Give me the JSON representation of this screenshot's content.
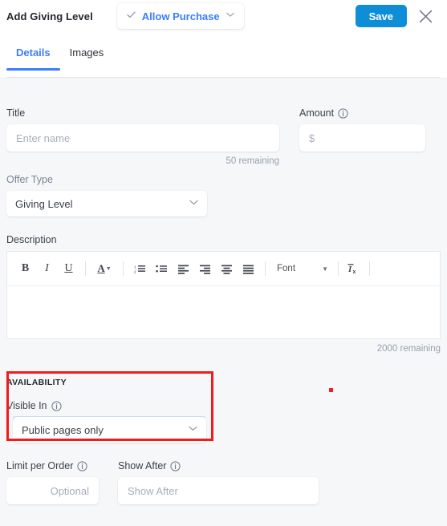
{
  "header": {
    "title": "Add Giving Level",
    "purchase_dropdown": {
      "check_icon": "check-icon",
      "label": "Allow Purchase",
      "caret_icon": "chevron-down-icon"
    },
    "save_label": "Save",
    "close_icon": "close-icon"
  },
  "tabs": [
    {
      "label": "Details",
      "active": true
    },
    {
      "label": "Images",
      "active": false
    }
  ],
  "form": {
    "title_field": {
      "label": "Title",
      "placeholder": "Enter name",
      "value": "",
      "counter": "50 remaining"
    },
    "amount_field": {
      "label": "Amount",
      "info_icon": "info-icon",
      "placeholder": "$",
      "value": ""
    },
    "offer_type": {
      "label": "Offer Type",
      "value": "Giving Level",
      "chevron_icon": "chevron-down-icon"
    },
    "description": {
      "label": "Description",
      "value": "",
      "counter": "2000 remaining",
      "toolbar": {
        "bold": "B",
        "italic": "I",
        "underline": "U",
        "text_color": "A",
        "ordered_list_icon": "ordered-list-icon",
        "bullet_list_icon": "bullet-list-icon",
        "align_left_icon": "align-left-icon",
        "align_right_icon": "align-right-icon",
        "align_center_icon": "align-center-icon",
        "justify_icon": "align-justify-icon",
        "font_label": "Font",
        "font_caret_icon": "caret-down-icon",
        "remove_format": "Ix"
      }
    },
    "availability": {
      "section_title": "AVAILABILITY",
      "visible_in": {
        "label": "Visible In",
        "info_icon": "info-icon",
        "value": "Public pages only",
        "chevron_icon": "chevron-down-icon"
      },
      "limit_per_order": {
        "label": "Limit per Order",
        "info_icon": "info-icon",
        "placeholder": "Optional",
        "value": ""
      },
      "show_after": {
        "label": "Show After",
        "info_icon": "info-icon",
        "placeholder": "Show After",
        "value": ""
      }
    }
  },
  "colors": {
    "accent_blue": "#3b7dfb",
    "save_blue": "#0e8ed6",
    "highlight_red": "#f01b1b",
    "background": "#f6f7f9"
  }
}
